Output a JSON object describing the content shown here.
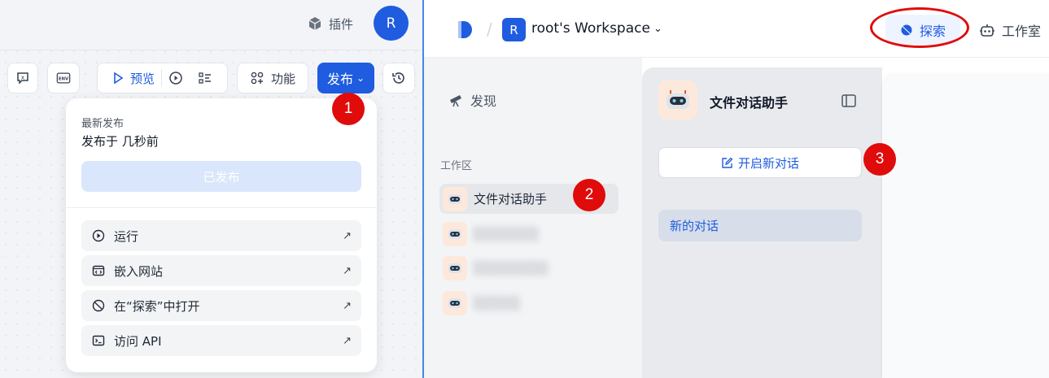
{
  "editor": {
    "header": {
      "plugins_label": "插件",
      "avatar_letter": "R"
    },
    "toolbar": {
      "preview_label": "预览",
      "features_label": "功能",
      "publish_label": "发布",
      "env_label": "ENV"
    },
    "publish_popup": {
      "latest_label": "最新发布",
      "published_time": "发布于 几秒前",
      "published_button": "已发布",
      "items": [
        {
          "label": "运行",
          "icon": "play-circle-icon"
        },
        {
          "label": "嵌入网站",
          "icon": "embed-icon"
        },
        {
          "label": "在“探索”中打开",
          "icon": "explore-icon"
        },
        {
          "label": "访问 API",
          "icon": "terminal-icon"
        }
      ],
      "arrow": "↗"
    }
  },
  "workspace": {
    "header": {
      "workspace_avatar": "R",
      "workspace_name": "root's Workspace",
      "explore_tab": "探索",
      "studio_tab": "工作室"
    },
    "sidebar": {
      "discover_label": "发现",
      "section_label": "工作区",
      "apps": [
        {
          "name": "文件对话助手",
          "active": true
        },
        {
          "name": "░░░░░░░",
          "blurred": true
        },
        {
          "name": "░░░░░░░░",
          "blurred": true
        },
        {
          "name": "░░░░░",
          "blurred": true
        }
      ]
    },
    "chat_panel": {
      "app_title": "文件对话助手",
      "new_chat_label": "开启新对话",
      "conversations": [
        "新的对话"
      ]
    }
  },
  "annotations": {
    "badges": [
      "1",
      "2",
      "3"
    ],
    "highlight_color": "#e00b0b"
  },
  "colors": {
    "accent": "#1f5ce0",
    "badge": "#e00b0b"
  }
}
